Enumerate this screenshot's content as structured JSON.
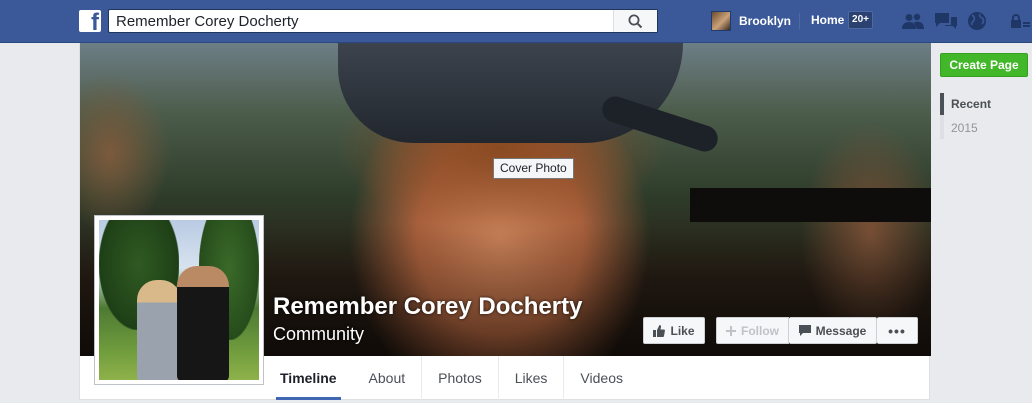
{
  "search": {
    "query": "Remember Corey Docherty"
  },
  "user": {
    "name": "Brooklyn"
  },
  "nav": {
    "home_label": "Home",
    "home_badge": "20+"
  },
  "cover": {
    "tooltip": "Cover Photo"
  },
  "page": {
    "name": "Remember Corey Docherty",
    "category": "Community"
  },
  "actions": {
    "like": "Like",
    "follow": "Follow",
    "message": "Message",
    "more": "•••"
  },
  "tabs": [
    "Timeline",
    "About",
    "Photos",
    "Likes",
    "Videos"
  ],
  "sidebar": {
    "create_page": "Create Page",
    "years": [
      "Recent",
      "2015"
    ]
  },
  "colors": {
    "header_blue": "#3b5998",
    "create_green": "#42b72a",
    "tab_underline": "#4267b2"
  },
  "icons": [
    "facebook-logo-icon",
    "search-icon",
    "friends-icon",
    "messages-icon",
    "globe-icon",
    "lock-icon",
    "thumbs-up-icon",
    "plus-icon",
    "message-icon"
  ]
}
